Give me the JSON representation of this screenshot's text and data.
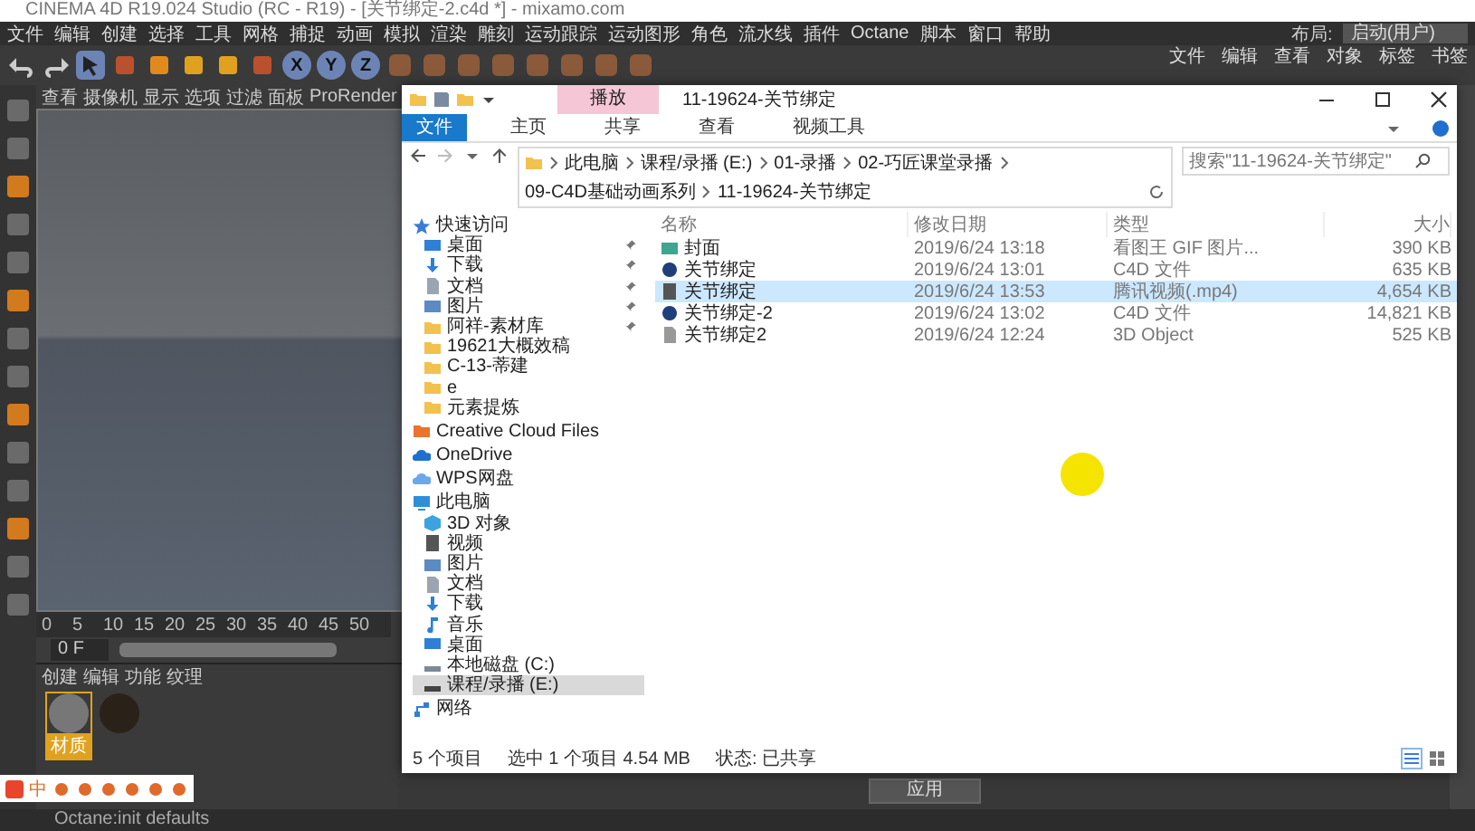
{
  "c4d": {
    "title": "CINEMA 4D R19.024 Studio (RC - R19) - [关节绑定-2.c4d *] - mixamo.com",
    "menu": [
      "文件",
      "编辑",
      "创建",
      "选择",
      "工具",
      "网格",
      "捕捉",
      "动画",
      "模拟",
      "渲染",
      "雕刻",
      "运动跟踪",
      "运动图形",
      "角色",
      "流水线",
      "插件",
      "Octane",
      "脚本",
      "窗口",
      "帮助"
    ],
    "layout_label": "布局:",
    "layout_value": "启动(用户)",
    "axis_buttons": [
      "X",
      "Y",
      "Z"
    ],
    "object_manager_menu": [
      "文件",
      "编辑",
      "查看",
      "对象",
      "标签",
      "书签"
    ],
    "viewport_menu": [
      "查看",
      "摄像机",
      "显示",
      "选项",
      "过滤",
      "面板",
      "ProRender"
    ],
    "timeline_ticks": [
      "0",
      "5",
      "10",
      "15",
      "20",
      "25",
      "30",
      "35",
      "40",
      "45",
      "50"
    ],
    "frame_field": "0 F",
    "material_menu": [
      "创建",
      "编辑",
      "功能",
      "纹理"
    ],
    "materials": [
      {
        "name": "材质",
        "selected": true
      },
      {
        "selected": false
      }
    ],
    "apply_button": "应用",
    "status": "Octane:init defaults"
  },
  "explorer": {
    "contextual_tab": "播放",
    "title": "11-19624-关节绑定",
    "ribbon_tabs": [
      {
        "label": "文件",
        "selected": true
      },
      {
        "label": "主页",
        "selected": false
      },
      {
        "label": "共享",
        "selected": false
      },
      {
        "label": "查看",
        "selected": false
      },
      {
        "label": "视频工具",
        "selected": false
      }
    ],
    "breadcrumb": [
      "此电脑",
      "课程/录播 (E:)",
      "01-录播",
      "02-巧匠课堂录播",
      "09-C4D基础动画系列",
      "11-19624-关节绑定"
    ],
    "search": {
      "placeholder": "搜索\"11-19624-关节绑定\""
    },
    "sidebar": [
      {
        "label": "快速访问",
        "kind": "star",
        "selected": false,
        "children": [
          {
            "label": "桌面",
            "kind": "desktop",
            "pinned": true,
            "selected": false
          },
          {
            "label": "下载",
            "kind": "download",
            "pinned": true,
            "selected": false
          },
          {
            "label": "文档",
            "kind": "doc",
            "pinned": true,
            "selected": false
          },
          {
            "label": "图片",
            "kind": "picture",
            "pinned": true,
            "selected": false
          },
          {
            "label": "阿祥-素材库",
            "kind": "folder",
            "pinned": true,
            "selected": false
          },
          {
            "label": "19621大概效稿",
            "kind": "folder",
            "pinned": false,
            "selected": false
          },
          {
            "label": "C-13-蒂建",
            "kind": "folder",
            "pinned": false,
            "selected": false
          },
          {
            "label": "e",
            "kind": "folder",
            "pinned": false,
            "selected": false
          },
          {
            "label": "元素提炼",
            "kind": "folder",
            "pinned": false,
            "selected": false
          }
        ]
      },
      {
        "label": "Creative Cloud Files",
        "kind": "ccfiles",
        "selected": false
      },
      {
        "label": "OneDrive",
        "kind": "onedrive",
        "selected": false
      },
      {
        "label": "WPS网盘",
        "kind": "wps",
        "selected": false
      },
      {
        "label": "此电脑",
        "kind": "pc",
        "selected": false,
        "children": [
          {
            "label": "3D 对象",
            "kind": "obj3d",
            "selected": false
          },
          {
            "label": "视频",
            "kind": "video",
            "selected": false
          },
          {
            "label": "图片",
            "kind": "picture",
            "selected": false
          },
          {
            "label": "文档",
            "kind": "doc",
            "selected": false
          },
          {
            "label": "下载",
            "kind": "download",
            "selected": false
          },
          {
            "label": "音乐",
            "kind": "music",
            "selected": false
          },
          {
            "label": "桌面",
            "kind": "desktop",
            "selected": false
          },
          {
            "label": "本地磁盘 (C:)",
            "kind": "drivec",
            "selected": false
          },
          {
            "label": "课程/录播 (E:)",
            "kind": "drive",
            "selected": true
          }
        ]
      },
      {
        "label": "网络",
        "kind": "network",
        "selected": false
      }
    ],
    "columns": [
      "名称",
      "修改日期",
      "类型",
      "大小"
    ],
    "files": [
      {
        "name": "封面",
        "date": "2019/6/24 13:18",
        "type": "看图王 GIF 图片...",
        "size": "390 KB",
        "kind": "image",
        "selected": false
      },
      {
        "name": "关节绑定",
        "date": "2019/6/24 13:01",
        "type": "C4D 文件",
        "size": "635 KB",
        "kind": "c4d",
        "selected": false
      },
      {
        "name": "关节绑定",
        "date": "2019/6/24 13:53",
        "type": "腾讯视频(.mp4)",
        "size": "4,654 KB",
        "kind": "video",
        "selected": true
      },
      {
        "name": "关节绑定-2",
        "date": "2019/6/24 13:02",
        "type": "C4D 文件",
        "size": "14,821 KB",
        "kind": "c4d",
        "selected": false
      },
      {
        "name": "关节绑定2",
        "date": "2019/6/24 12:24",
        "type": "3D Object",
        "size": "525 KB",
        "kind": "model",
        "selected": false
      }
    ],
    "status": {
      "count": "5 个项目",
      "selection": "选中 1 个项目  4.54 MB",
      "share": "状态: 已共享"
    }
  },
  "ime": {
    "mode": "中"
  }
}
